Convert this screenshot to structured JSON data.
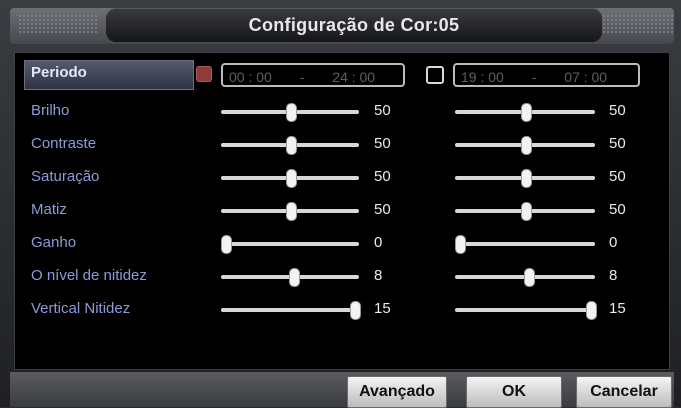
{
  "dialog": {
    "title": "Configuração de Cor:05"
  },
  "period": {
    "label": "Periodo",
    "range1": {
      "start": "00 : 00",
      "sep": "-",
      "end": "24 : 00",
      "checked": true
    },
    "range2": {
      "start": "19 : 00",
      "sep": "-",
      "end": "07 : 00",
      "checked": false
    }
  },
  "rows": [
    {
      "label": "Brilho",
      "left": {
        "value": "50",
        "fraction": 0.5
      },
      "right": {
        "value": "50",
        "fraction": 0.5
      }
    },
    {
      "label": "Contraste",
      "left": {
        "value": "50",
        "fraction": 0.5
      },
      "right": {
        "value": "50",
        "fraction": 0.5
      }
    },
    {
      "label": "Saturação",
      "left": {
        "value": "50",
        "fraction": 0.5
      },
      "right": {
        "value": "50",
        "fraction": 0.5
      }
    },
    {
      "label": "Matiz",
      "left": {
        "value": "50",
        "fraction": 0.5
      },
      "right": {
        "value": "50",
        "fraction": 0.5
      }
    },
    {
      "label": "Ganho",
      "left": {
        "value": "0",
        "fraction": 0.0
      },
      "right": {
        "value": "0",
        "fraction": 0.0
      }
    },
    {
      "label": "O nível de nitidez",
      "left": {
        "value": "8",
        "fraction": 0.53
      },
      "right": {
        "value": "8",
        "fraction": 0.53
      }
    },
    {
      "label": "Vertical Nitidez",
      "left": {
        "value": "15",
        "fraction": 1.0
      },
      "right": {
        "value": "15",
        "fraction": 1.0
      }
    }
  ],
  "buttons": {
    "advanced": "Avançado",
    "ok": "OK",
    "cancel": "Cancelar"
  },
  "colors": {
    "label": "#8e9bd6",
    "selected_label": "#e6e6ff",
    "checkbox_checked": "#8e3b3b"
  }
}
